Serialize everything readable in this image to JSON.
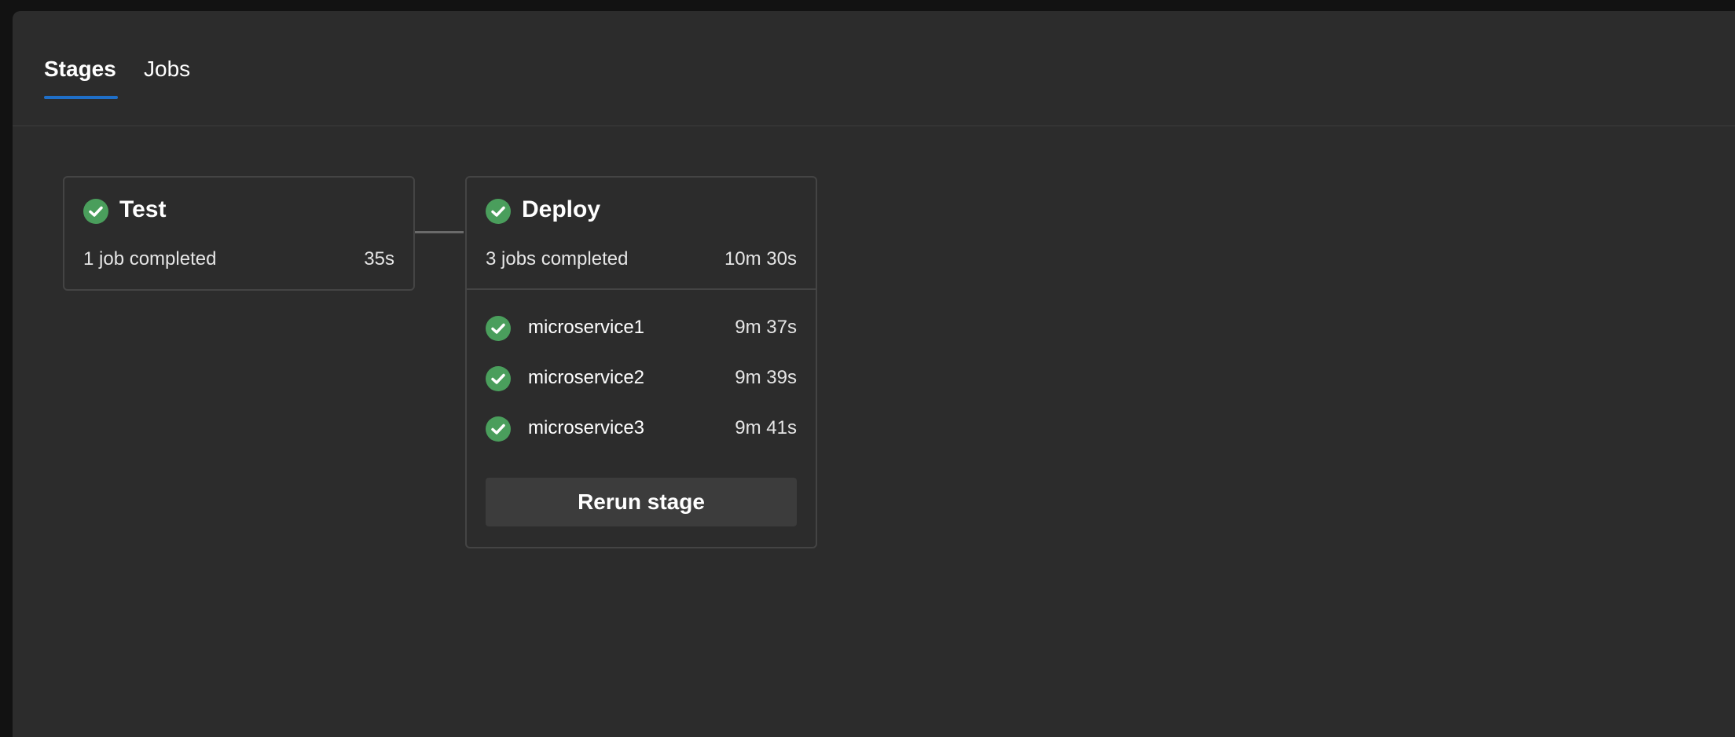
{
  "tabs": [
    {
      "label": "Stages",
      "active": true
    },
    {
      "label": "Jobs",
      "active": false
    }
  ],
  "colors": {
    "accent": "#1f6fc8",
    "success": "#4a9e5c",
    "background": "#2c2c2c"
  },
  "stages": [
    {
      "name": "Test",
      "status_icon": "check-circle-icon",
      "summary": "1 job completed",
      "duration": "35s"
    },
    {
      "name": "Deploy",
      "status_icon": "check-circle-icon",
      "summary": "3 jobs completed",
      "duration": "10m 30s",
      "jobs": [
        {
          "name": "microservice1",
          "duration": "9m 37s"
        },
        {
          "name": "microservice2",
          "duration": "9m 39s"
        },
        {
          "name": "microservice3",
          "duration": "9m 41s"
        }
      ],
      "action_label": "Rerun stage"
    }
  ]
}
